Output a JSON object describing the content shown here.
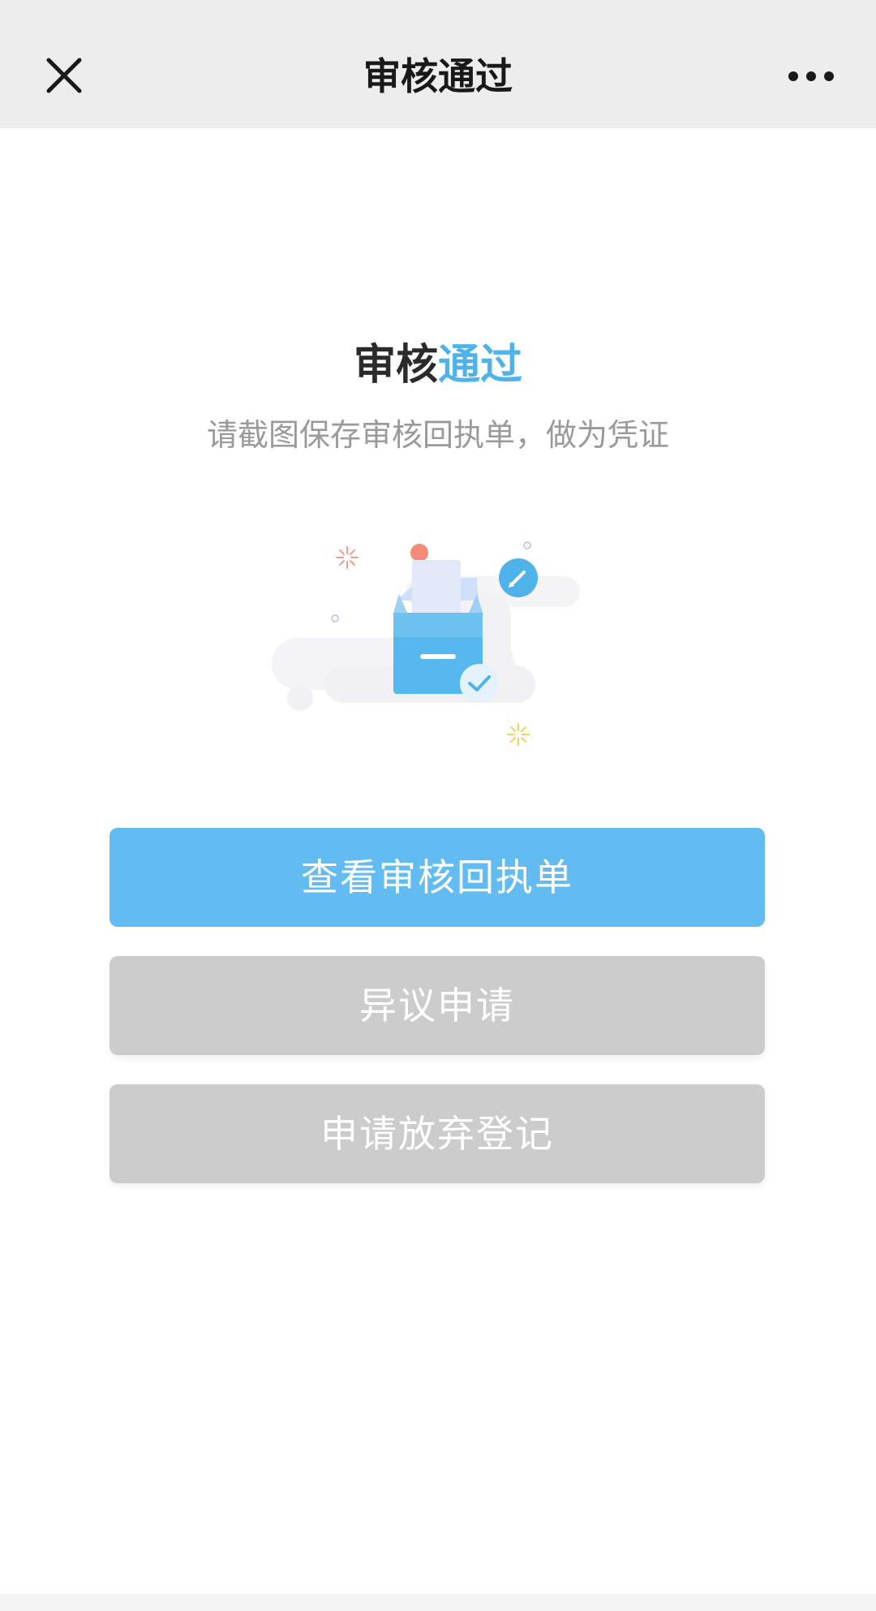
{
  "nav": {
    "title": "审核通过",
    "close_icon": "close-icon",
    "more_icon": "more-horizontal-icon"
  },
  "status": {
    "heading_part1": "审核",
    "heading_part2": "通过",
    "subtitle": "请截图保存审核回执单，做为凭证"
  },
  "illustration": {
    "icon": "approved-box-illustration"
  },
  "actions": {
    "view_receipt_label": "查看审核回执单",
    "objection_label": "异议申请",
    "abandon_label": "申请放弃登记"
  },
  "colors": {
    "accent": "#4fb3ea",
    "primary_button": "#63bcf1",
    "disabled_button": "#cccccc",
    "nav_background": "#ededed"
  }
}
